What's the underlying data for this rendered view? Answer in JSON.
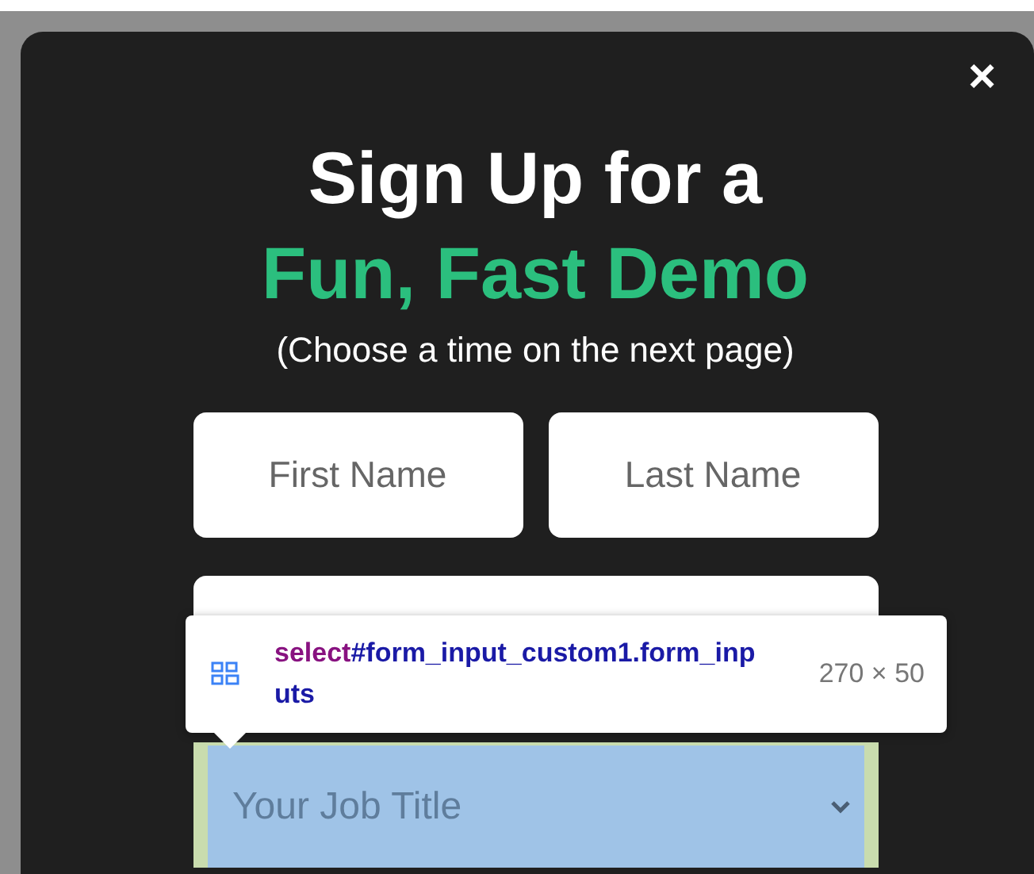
{
  "modal": {
    "close": "×",
    "title": "Sign Up for a",
    "highlight": "Fun, Fast Demo",
    "subtitle": "(Choose a time on the next page)",
    "name_fields": [
      {
        "placeholder": "First Name"
      },
      {
        "placeholder": "Last Name"
      }
    ],
    "job_select": {
      "placeholder": "Your Job Title",
      "highlighted": true
    }
  },
  "inspector_tooltip": {
    "tag": "select",
    "selector": "#form_input_custom1.form_inputs",
    "size": "270 × 50"
  }
}
